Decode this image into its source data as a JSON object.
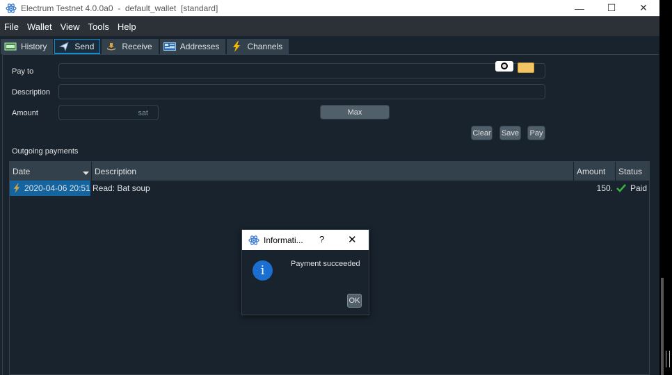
{
  "window": {
    "title": "Electrum Testnet 4.0.0a0  -  default_wallet  [standard]",
    "minimize": "—",
    "maximize": "☐",
    "close": "✕"
  },
  "menu": [
    "File",
    "Wallet",
    "View",
    "Tools",
    "Help"
  ],
  "tabs": [
    {
      "label": "History",
      "icon": "history-icon",
      "active": false
    },
    {
      "label": "Send",
      "icon": "send-icon",
      "active": true
    },
    {
      "label": "Receive",
      "icon": "receive-icon",
      "active": false
    },
    {
      "label": "Addresses",
      "icon": "addresses-icon",
      "active": false
    },
    {
      "label": "Channels",
      "icon": "lightning-icon",
      "active": false
    }
  ],
  "send_form": {
    "pay_to_label": "Pay to",
    "pay_to_value": "",
    "description_label": "Description",
    "description_value": "",
    "amount_label": "Amount",
    "amount_value": "",
    "amount_unit": "sat",
    "max_button": "Max",
    "clear_button": "Clear",
    "save_button": "Save",
    "pay_button": "Pay"
  },
  "outgoing": {
    "label": "Outgoing payments",
    "columns": [
      "Date",
      "Description",
      "Amount",
      "Status"
    ],
    "rows": [
      {
        "date": "2020-04-06 20:51",
        "description": "Read: Bat soup",
        "amount": "150.",
        "status": "Paid"
      }
    ]
  },
  "dialog": {
    "title": "Informati...",
    "help": "?",
    "close": "✕",
    "message": "Payment succeeded",
    "ok": "OK"
  },
  "colors": {
    "background": "#19232d",
    "accent": "#148cd2",
    "selection": "#1464a0",
    "paid_check": "#3cb043",
    "info_icon": "#1a6fd0"
  }
}
